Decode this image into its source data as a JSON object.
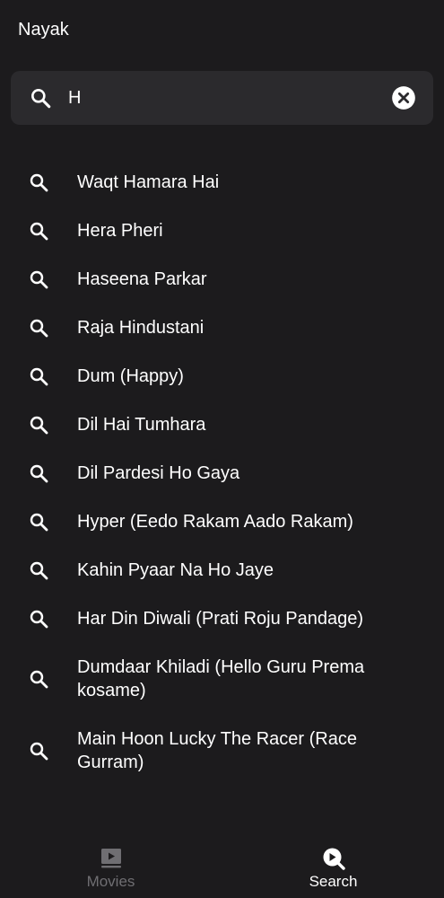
{
  "header": {
    "title": "Nayak"
  },
  "search": {
    "value": "H",
    "placeholder": ""
  },
  "suggestions": [
    "Waqt Hamara Hai",
    "Hera Pheri",
    "Haseena Parkar",
    "Raja Hindustani",
    "Dum (Happy)",
    "Dil Hai Tumhara",
    "Dil Pardesi Ho Gaya",
    "Hyper (Eedo Rakam Aado Rakam)",
    "Kahin Pyaar Na Ho Jaye",
    "Har Din Diwali (Prati Roju Pandage)",
    "Dumdaar Khiladi (Hello Guru Prema kosame)",
    "Main Hoon Lucky The Racer (Race Gurram)"
  ],
  "bottom_nav": {
    "movies_label": "Movies",
    "search_label": "Search",
    "active": "search"
  },
  "icons": {
    "search_bar": "search-icon",
    "clear": "clear-icon",
    "suggestion": "search-icon",
    "movies": "movies-icon",
    "search_tab": "search-tab-icon"
  },
  "colors": {
    "background": "#1c1b1d",
    "search_bar": "#2b2a2d",
    "text": "#ffffff",
    "inactive": "#6f6e72"
  }
}
